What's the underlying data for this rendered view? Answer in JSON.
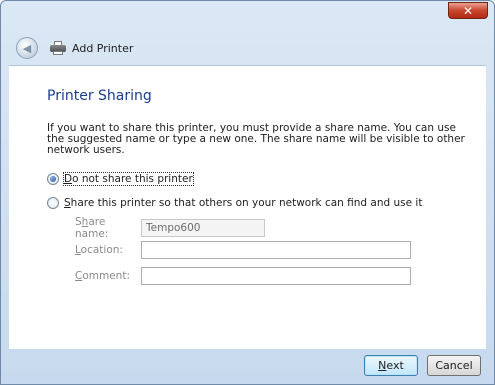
{
  "window": {
    "title": "Add Printer",
    "close_glyph": "✕"
  },
  "page": {
    "title": "Printer Sharing",
    "description": "If you want to share this printer, you must provide a share name. You can use the suggested name or type a new one. The share name will be visible to other network users."
  },
  "sharing_options": [
    {
      "label_mnemonic": "D",
      "label_rest": "o not share this printer",
      "checked": true
    },
    {
      "label_mnemonic": "S",
      "label_rest": "hare this printer so that others on your network can find and use it",
      "checked": false
    }
  ],
  "fields": {
    "share_name": {
      "label_pre": "S",
      "label_mnemonic": "h",
      "label_post": "are name:",
      "value": "Tempo600"
    },
    "location": {
      "label_pre": "",
      "label_mnemonic": "L",
      "label_post": "ocation:",
      "value": ""
    },
    "comment": {
      "label_pre": "",
      "label_mnemonic": "C",
      "label_post": "omment:",
      "value": ""
    }
  },
  "buttons": {
    "next_mnemonic": "N",
    "next_rest": "ext",
    "cancel": "Cancel"
  },
  "icons": {
    "back": "back-arrow-icon",
    "printer": "printer-icon",
    "close": "close-icon"
  },
  "colors": {
    "title_blue": "#1a3e8c",
    "close_red": "#c9452e"
  }
}
